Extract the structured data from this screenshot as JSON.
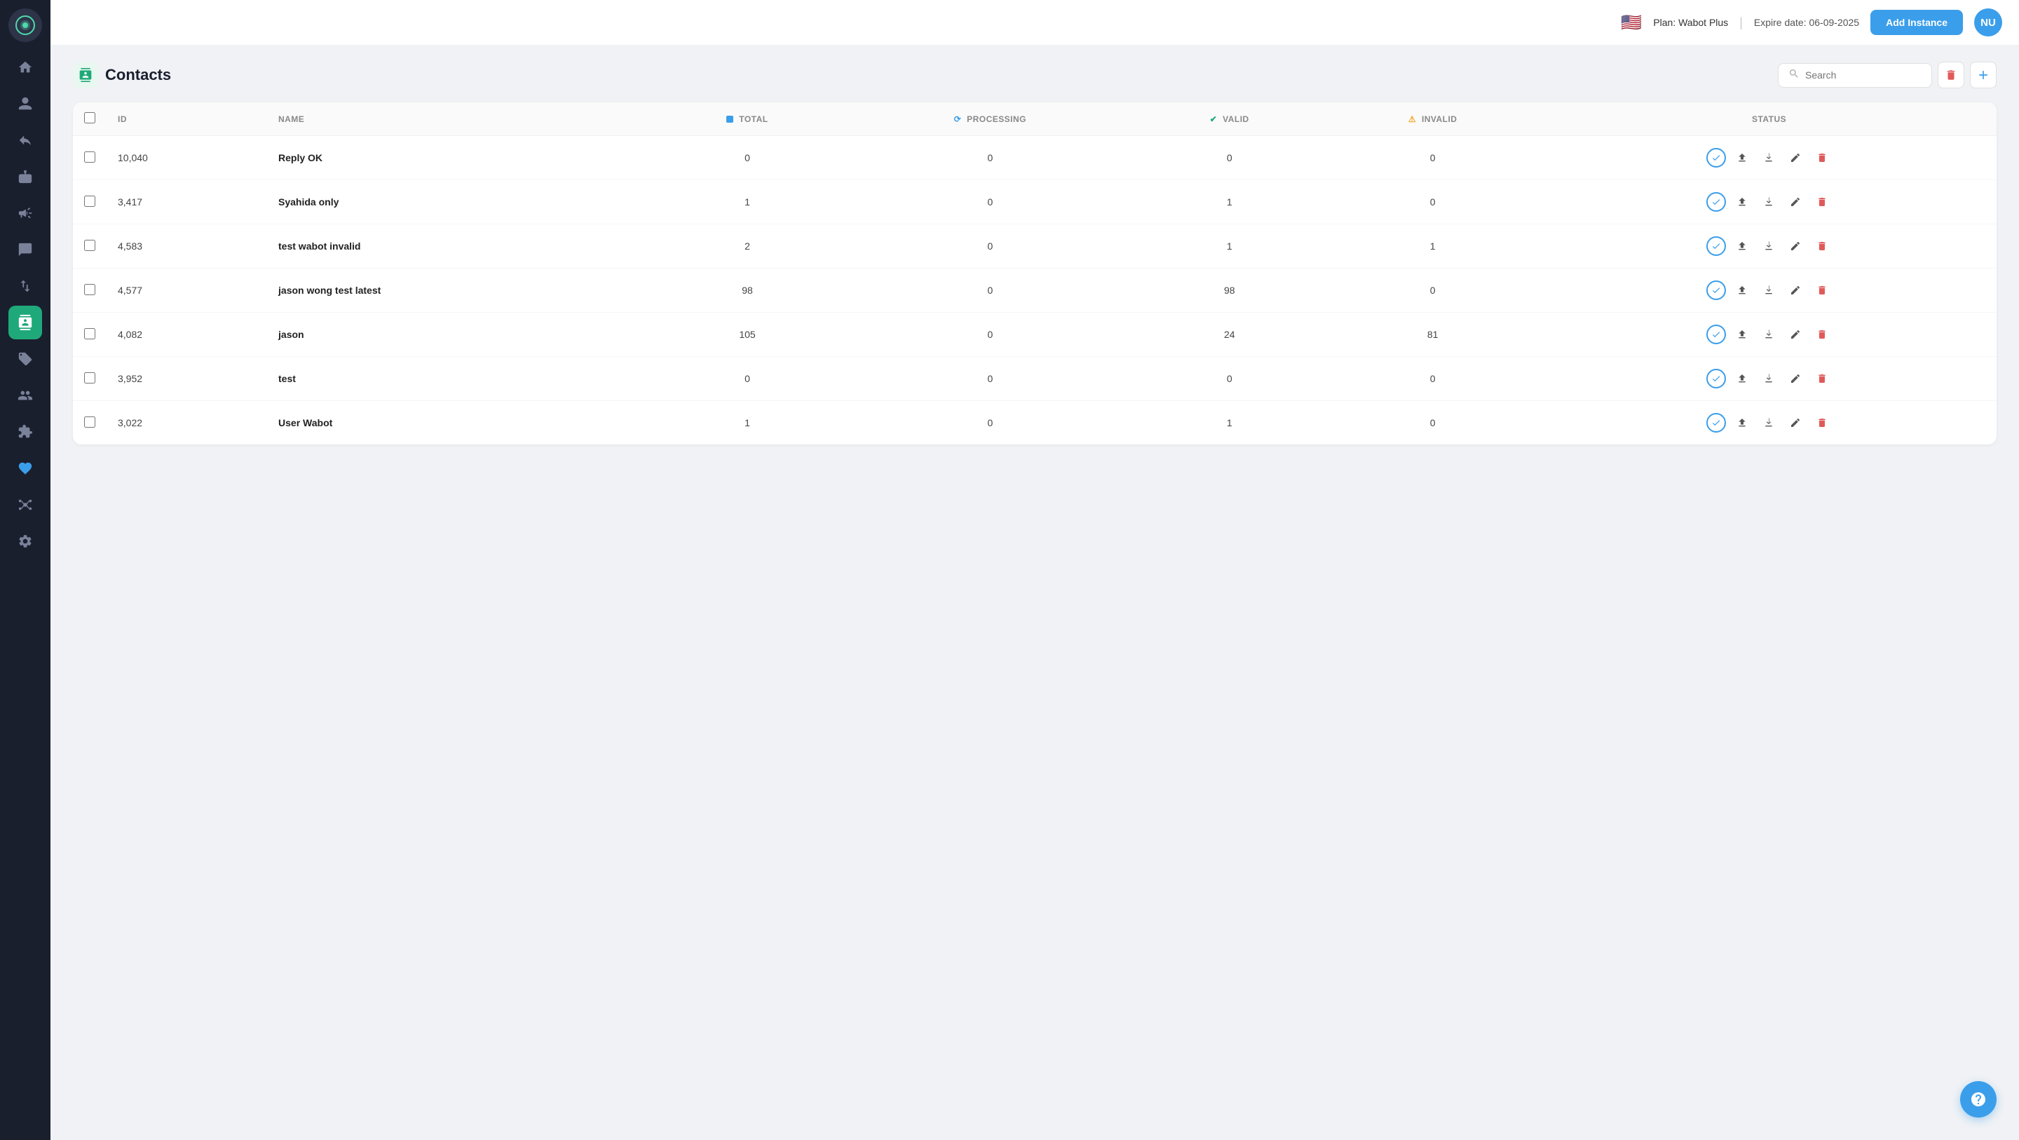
{
  "header": {
    "flag": "🇺🇸",
    "plan_label": "Plan: Wabot Plus",
    "expire_label": "Expire date: 06-09-2025",
    "add_instance_label": "Add Instance",
    "avatar_initials": "NU"
  },
  "page": {
    "title": "Contacts",
    "search_placeholder": "Search"
  },
  "table": {
    "columns": {
      "id": "ID",
      "name": "NAME",
      "total": "TOTAL",
      "processing": "PROCESSING",
      "valid": "VALID",
      "invalid": "INVALID",
      "status": "STATUS"
    },
    "rows": [
      {
        "id": "10,040",
        "name": "Reply OK",
        "total": 0,
        "processing": 0,
        "valid": 0,
        "invalid": 0
      },
      {
        "id": "3,417",
        "name": "Syahida only",
        "total": 1,
        "processing": 0,
        "valid": 1,
        "invalid": 0
      },
      {
        "id": "4,583",
        "name": "test wabot invalid",
        "total": 2,
        "processing": 0,
        "valid": 1,
        "invalid": 1
      },
      {
        "id": "4,577",
        "name": "jason wong test latest",
        "total": 98,
        "processing": 0,
        "valid": 98,
        "invalid": 0
      },
      {
        "id": "4,082",
        "name": "jason",
        "total": 105,
        "processing": 0,
        "valid": 24,
        "invalid": 81
      },
      {
        "id": "3,952",
        "name": "test",
        "total": 0,
        "processing": 0,
        "valid": 0,
        "invalid": 0
      },
      {
        "id": "3,022",
        "name": "User Wabot",
        "total": 1,
        "processing": 0,
        "valid": 1,
        "invalid": 0
      }
    ]
  },
  "sidebar": {
    "items": [
      {
        "name": "home",
        "icon": "🏠"
      },
      {
        "name": "user",
        "icon": "👤"
      },
      {
        "name": "reply",
        "icon": "↩"
      },
      {
        "name": "bot",
        "icon": "🤖"
      },
      {
        "name": "megaphone",
        "icon": "📣"
      },
      {
        "name": "chat",
        "icon": "💬"
      },
      {
        "name": "export",
        "icon": "📤"
      },
      {
        "name": "contacts",
        "icon": "👥",
        "active": true
      },
      {
        "name": "tags",
        "icon": "🏷"
      },
      {
        "name": "team",
        "icon": "👫"
      },
      {
        "name": "plugin",
        "icon": "🔌"
      },
      {
        "name": "heart",
        "icon": "💙"
      },
      {
        "name": "settings2",
        "icon": "⚙"
      },
      {
        "name": "settings",
        "icon": "⚙"
      }
    ]
  }
}
